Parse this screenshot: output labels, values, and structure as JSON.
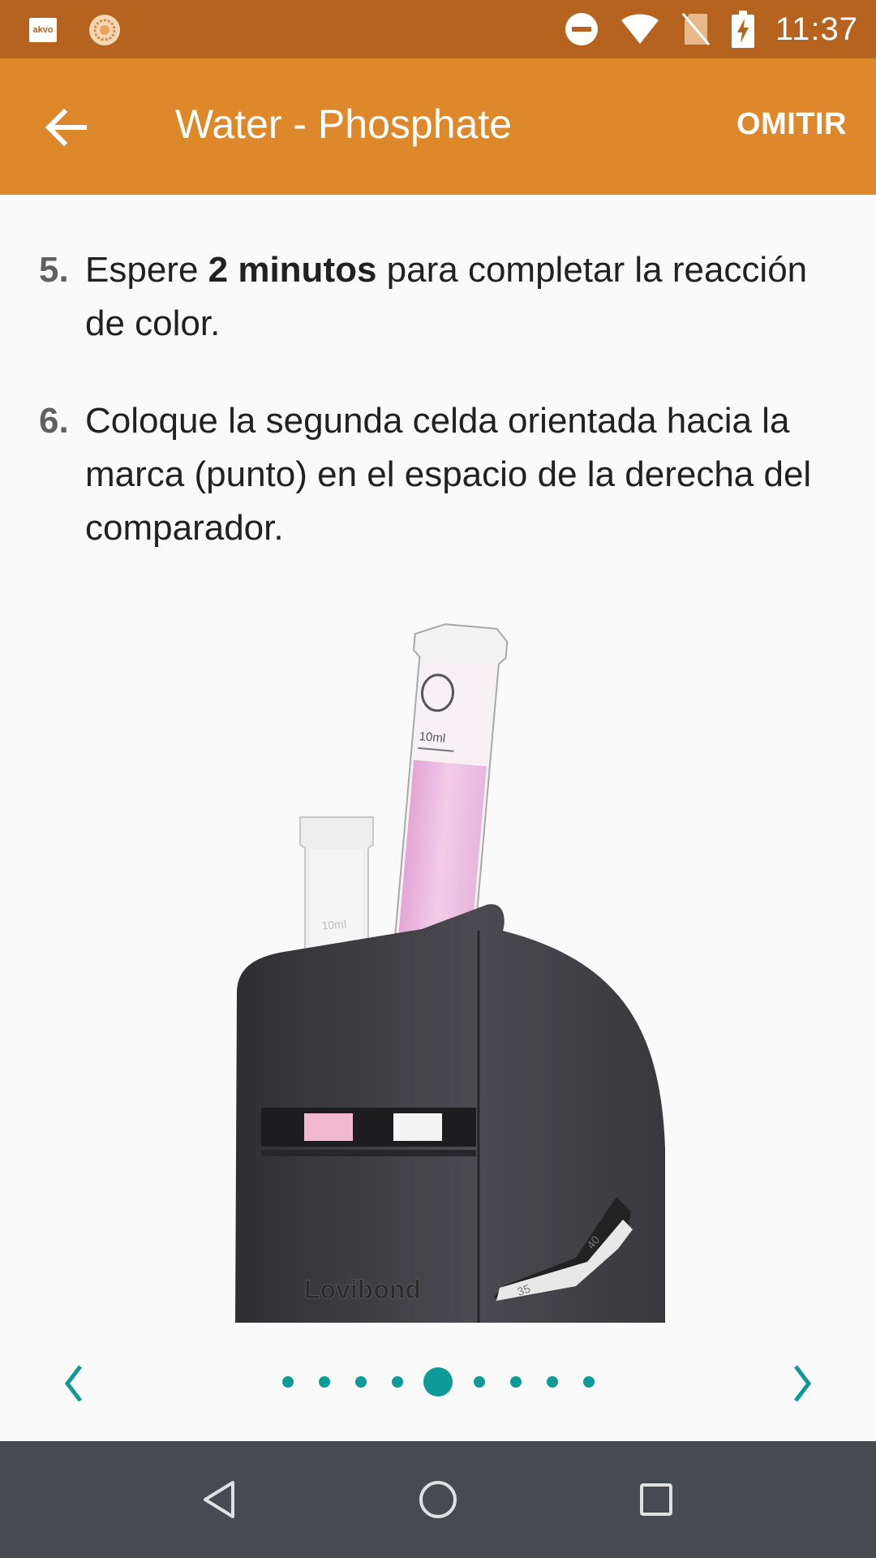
{
  "status_bar": {
    "app_icon_label": "akvo",
    "time": "11:37",
    "icons": [
      "akvo-app-icon",
      "sun-icon",
      "do-not-disturb-icon",
      "wifi-icon",
      "no-sim-icon",
      "battery-charging-icon"
    ]
  },
  "app_bar": {
    "title": "Water - Phosphate",
    "skip_label": "OMITIR",
    "back_icon": "arrow-left-icon"
  },
  "steps": [
    {
      "number": "5.",
      "text_before": "Espere ",
      "text_bold": "2 minutos",
      "text_after": " para completar la reacción de color."
    },
    {
      "number": "6.",
      "text": "Coloque la segunda celda orientada hacia la marca (punto) en el espacio de la derecha del comparador."
    }
  ],
  "illustration": {
    "tube_label_front": "10ml",
    "tube_label_back": "10ml",
    "brand": "Lovibond",
    "dial_values": [
      "40",
      "35"
    ]
  },
  "pager": {
    "total": 9,
    "active_index": 4,
    "prev_icon": "chevron-left-icon",
    "next_icon": "chevron-right-icon",
    "accent_color": "#0e9a96"
  },
  "nav_bar": {
    "icons": [
      "nav-back-icon",
      "nav-home-icon",
      "nav-recents-icon"
    ]
  },
  "colors": {
    "status_bar": "#b5631e",
    "app_bar": "#de882c",
    "background": "#fafafa",
    "nav_bar": "#454b51"
  }
}
